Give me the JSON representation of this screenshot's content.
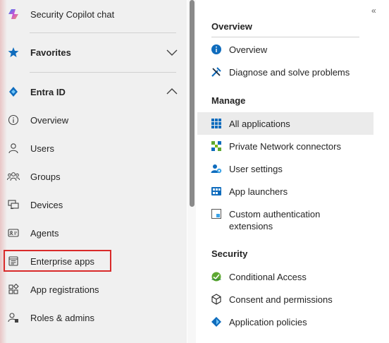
{
  "left_nav": {
    "copilot_label": "Security Copilot chat",
    "favorites_label": "Favorites",
    "entra_label": "Entra ID",
    "items": [
      {
        "label": "Overview"
      },
      {
        "label": "Users"
      },
      {
        "label": "Groups"
      },
      {
        "label": "Devices"
      },
      {
        "label": "Agents"
      },
      {
        "label": "Enterprise apps"
      },
      {
        "label": "App registrations"
      },
      {
        "label": "Roles & admins"
      }
    ],
    "highlighted_item": "Enterprise apps"
  },
  "right_panel": {
    "collapse_icon": "«",
    "sections": [
      {
        "title": "Overview",
        "items": [
          {
            "label": "Overview"
          },
          {
            "label": "Diagnose and solve problems"
          }
        ]
      },
      {
        "title": "Manage",
        "items": [
          {
            "label": "All applications",
            "selected": true
          },
          {
            "label": "Private Network connectors"
          },
          {
            "label": "User settings"
          },
          {
            "label": "App launchers"
          },
          {
            "label": "Custom authentication extensions"
          }
        ]
      },
      {
        "title": "Security",
        "items": [
          {
            "label": "Conditional Access"
          },
          {
            "label": "Consent and permissions"
          },
          {
            "label": "Application policies"
          }
        ]
      }
    ]
  },
  "colors": {
    "nav_bg": "#f0f0f0",
    "accent_blue": "#0f6cbd",
    "highlight_red": "#d92a2a",
    "selected_bg": "#ebebeb"
  }
}
